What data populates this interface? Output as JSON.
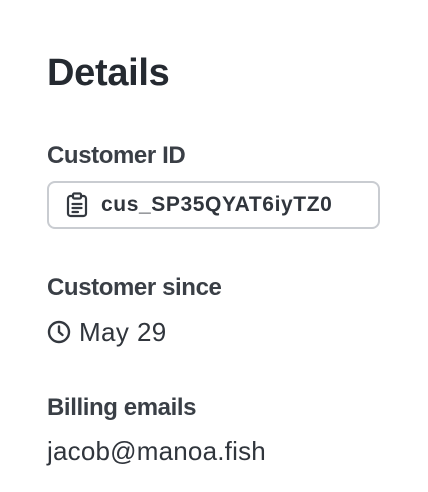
{
  "details": {
    "title": "Details",
    "customer_id": {
      "label": "Customer ID",
      "value": "cus_SP35QYAT6iyTZ0",
      "icon": "clipboard-icon"
    },
    "customer_since": {
      "label": "Customer since",
      "value": "May 29",
      "icon": "clock-icon"
    },
    "billing_emails": {
      "label": "Billing emails",
      "values": [
        "jacob@manoa.fish"
      ]
    }
  },
  "colors": {
    "text": "#2a2f36",
    "chip_border": "#c9ccd1",
    "background": "#ffffff"
  }
}
